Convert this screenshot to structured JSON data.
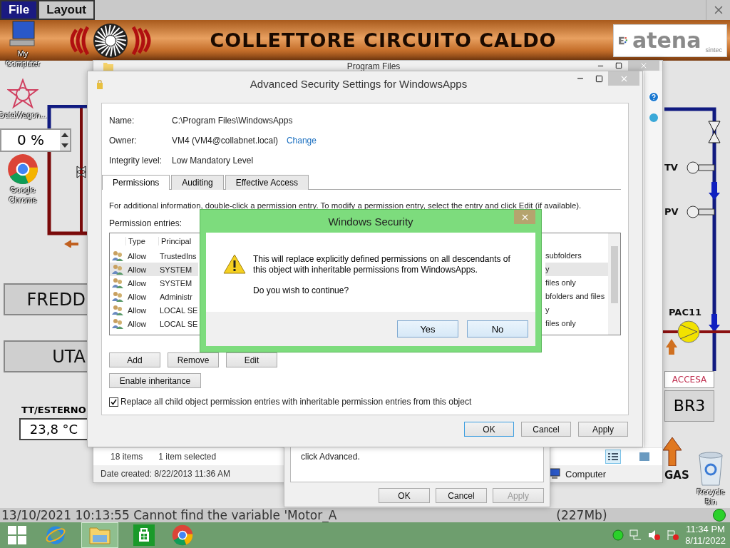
{
  "app": {
    "menu": [
      {
        "label": "File",
        "selected": true
      },
      {
        "label": "Layout",
        "selected": false
      }
    ],
    "title": "COLLETTORE CIRCUITO CALDO",
    "logo": {
      "name": "atena",
      "tagline": "sintec"
    },
    "spinner_value": "0 %",
    "buttons": [
      "FREDD",
      "UTA"
    ],
    "outdoor": {
      "label": "TT/ESTERNO",
      "value": "23,8 °C"
    },
    "instruments": [
      "TV",
      "PV"
    ],
    "pump": "PAC11",
    "burner": {
      "status": "ACCESA",
      "name": "BR3"
    },
    "fuel": "GAS",
    "log": "13/10/2021 10:13:55 Cannot find the variable 'Motor_A",
    "memory": "(227Mb)"
  },
  "desktop_icons": [
    {
      "kind": "computer",
      "label": "My Computer"
    },
    {
      "kind": "datawagon",
      "label": "DataWagon..."
    },
    {
      "kind": "chrome",
      "label": "Google Chrome"
    },
    {
      "kind": "recycle",
      "label": "Recycle Bin"
    }
  ],
  "explorer": {
    "title": "Program Files",
    "item_count": "18 items",
    "selection": "1 item selected",
    "date_created": "Date created: 8/22/2013 11:36 AM",
    "nav_item": "Computer"
  },
  "properties": {
    "hint": "click Advanced.",
    "buttons": [
      {
        "label": "OK",
        "disabled": false
      },
      {
        "label": "Cancel",
        "disabled": false
      },
      {
        "label": "Apply",
        "disabled": true
      }
    ]
  },
  "security": {
    "title": "Advanced Security Settings for WindowsApps",
    "fields": [
      {
        "label": "Name:",
        "value": "C:\\Program Files\\WindowsApps"
      },
      {
        "label": "Owner:",
        "value": "VM4 (VM4@collabnet.local)",
        "link": "Change"
      },
      {
        "label": "Integrity level:",
        "value": "Low Mandatory Level"
      }
    ],
    "tabs": [
      {
        "label": "Permissions",
        "selected": true
      },
      {
        "label": "Auditing",
        "selected": false
      },
      {
        "label": "Effective Access",
        "selected": false
      }
    ],
    "info": "For additional information, double-click a permission entry. To modify a permission entry, select the entry and click Edit (if available).",
    "entries_label": "Permission entries:",
    "columns": [
      "Type",
      "Principal"
    ],
    "entries": [
      {
        "type": "Allow",
        "principal": "TrustedIns",
        "applies_to": "subfolders",
        "selected": false
      },
      {
        "type": "Allow",
        "principal": "SYSTEM",
        "applies_to": "y",
        "selected": true
      },
      {
        "type": "Allow",
        "principal": "SYSTEM",
        "applies_to": "files only",
        "selected": false
      },
      {
        "type": "Allow",
        "principal": "Administr",
        "applies_to": "bfolders and files",
        "selected": false
      },
      {
        "type": "Allow",
        "principal": "LOCAL SE",
        "applies_to": "y",
        "selected": false
      },
      {
        "type": "Allow",
        "principal": "LOCAL SE",
        "applies_to": "files only",
        "selected": false
      }
    ],
    "entry_buttons": [
      "Add",
      "Remove",
      "Edit"
    ],
    "inheritance_button": "Enable inheritance",
    "replace_option": {
      "label": "Replace all child object permission entries with inheritable permission entries from this object",
      "checked": true
    },
    "buttons": [
      {
        "label": "OK",
        "default": true
      },
      {
        "label": "Cancel",
        "default": false
      },
      {
        "label": "Apply",
        "default": false
      }
    ]
  },
  "confirm": {
    "title": "Windows Security",
    "message": "This will replace explicitly defined permissions on all descendants of this object with inheritable permissions from WindowsApps.",
    "question": "Do you wish to continue?",
    "buttons": [
      "Yes",
      "No"
    ]
  },
  "taskbar": {
    "apps": [
      {
        "kind": "start",
        "selected": false
      },
      {
        "kind": "browser",
        "selected": false
      },
      {
        "kind": "folder",
        "selected": true
      },
      {
        "kind": "store",
        "selected": false
      },
      {
        "kind": "chrome",
        "selected": false
      }
    ],
    "time": "11:34 PM",
    "date": "8/11/2022"
  }
}
